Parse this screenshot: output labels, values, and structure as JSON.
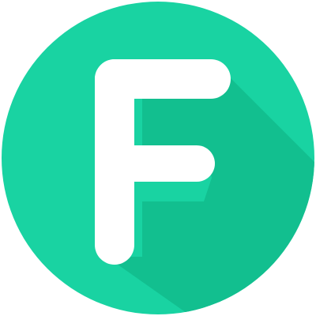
{
  "app_icon": {
    "letter": "F",
    "icon_name": "letter-f-app-icon",
    "colors": {
      "circle": "#19d3a2",
      "long_shadow": "#12bf8f",
      "letter": "#ffffff",
      "background": "#ffffff"
    }
  }
}
